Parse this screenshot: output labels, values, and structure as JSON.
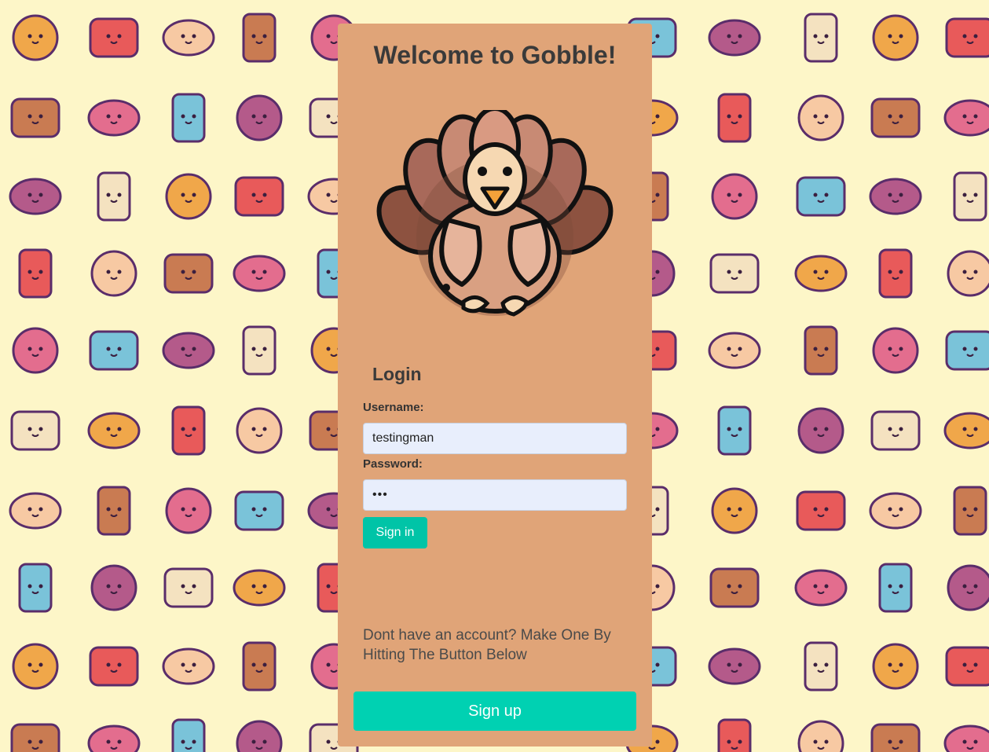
{
  "page": {
    "title": "Welcome to Gobble!",
    "background_color": "#fdf6c8",
    "panel_color": "#e0a478"
  },
  "login": {
    "heading": "Login",
    "username_label": "Username:",
    "username_value": "testingman",
    "password_label": "Password:",
    "password_value": "abc",
    "signin_label": "Sign in",
    "signin_color": "#00c4a7"
  },
  "signup": {
    "prompt": "Dont have an account? Make One By Hitting The Button Below",
    "button_label": "Sign up",
    "button_color": "#00d1b2"
  },
  "icons": {
    "mascot": "turkey-icon",
    "background": "food-pattern"
  }
}
